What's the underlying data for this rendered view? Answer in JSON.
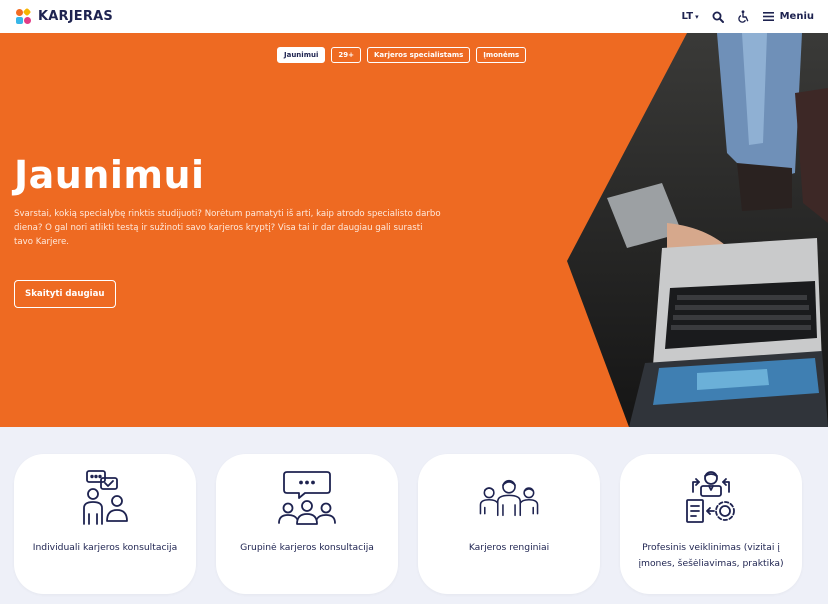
{
  "header": {
    "logo_text": "KARJERAS",
    "lang": "LT",
    "menu_label": "Meniu"
  },
  "hero": {
    "tabs": [
      {
        "label": "Jaunimui",
        "active": true
      },
      {
        "label": "29+",
        "active": false
      },
      {
        "label": "Karjeros specialistams",
        "active": false
      },
      {
        "label": "Įmonėms",
        "active": false
      }
    ],
    "title": "Jaunimui",
    "description": "Svarstai, kokią specialybę rinktis studijuoti? Norėtum pamatyti iš arti, kaip atrodo specialisto darbo diena? O gal nori atlikti testą ir sužinoti savo karjeros kryptį? Visa tai ir dar daugiau gali surasti tavo Karjere.",
    "button_label": "Skaityti daugiau"
  },
  "cards": [
    {
      "label": "Individuali karjeros konsultacija",
      "icon": "individual-consultation-icon"
    },
    {
      "label": "Grupinė karjeros konsultacija",
      "icon": "group-consultation-icon"
    },
    {
      "label": "Karjeros renginiai",
      "icon": "events-icon"
    },
    {
      "label": "Profesinis veiklinimas (vizitai į įmones, šešėliavimas, praktika)",
      "icon": "professional-activation-icon"
    }
  ],
  "colors": {
    "accent": "#ee6a22",
    "navy": "#1e2350",
    "background": "#eef0f8"
  }
}
